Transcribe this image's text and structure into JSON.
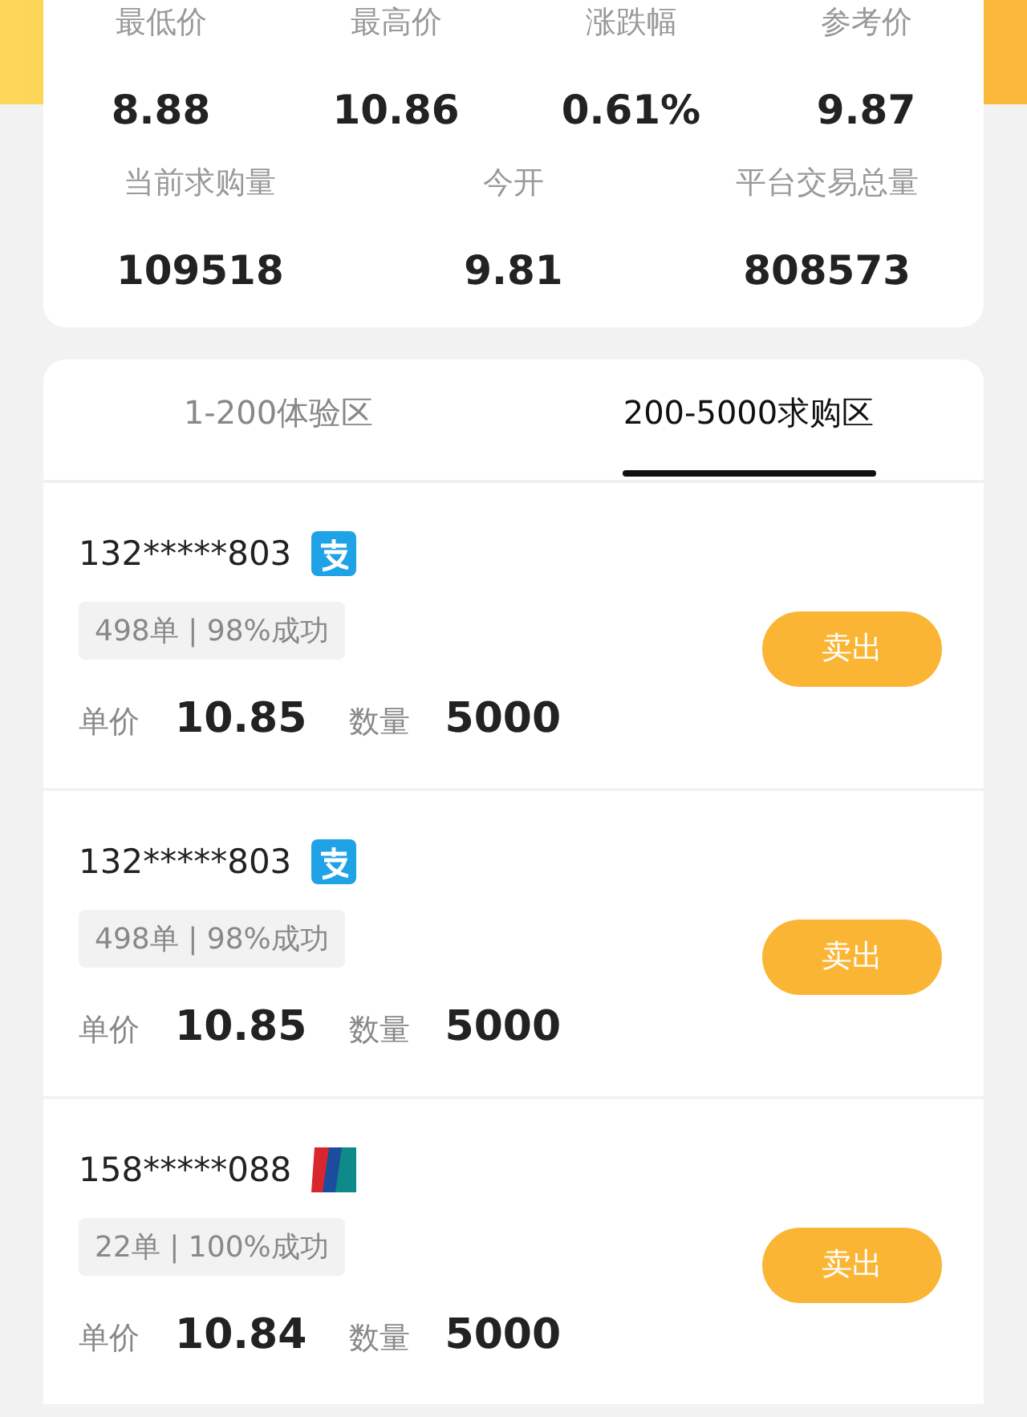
{
  "stats_row_1": [
    {
      "label": "最低价",
      "value": "8.88"
    },
    {
      "label": "最高价",
      "value": "10.86"
    },
    {
      "label": "涨跌幅",
      "value": "0.61%"
    },
    {
      "label": "参考价",
      "value": "9.87"
    }
  ],
  "stats_row_2": [
    {
      "label": "当前求购量",
      "value": "109518"
    },
    {
      "label": "今开",
      "value": "9.81"
    },
    {
      "label": "平台交易总量",
      "value": "808573"
    }
  ],
  "tabs": [
    {
      "label": "1-200体验区",
      "selected": false
    },
    {
      "label": "200-5000求购区",
      "selected": true
    }
  ],
  "orders": [
    {
      "user": "132*****803",
      "payment": {
        "kind": "alipay"
      },
      "record": "498单 | 98%成功",
      "price_label": "单价",
      "price": "10.85",
      "qty_label": "数量",
      "qty": "5000",
      "button": "卖出"
    },
    {
      "user": "132*****803",
      "payment": {
        "kind": "alipay"
      },
      "record": "498单 | 98%成功",
      "price_label": "单价",
      "price": "10.85",
      "qty_label": "数量",
      "qty": "5000",
      "button": "卖出"
    },
    {
      "user": "158*****088",
      "payment": {
        "kind": "unionpay"
      },
      "record": "22单 | 100%成功",
      "price_label": "单价",
      "price": "10.84",
      "qty_label": "数量",
      "qty": "5000",
      "button": "卖出"
    }
  ]
}
